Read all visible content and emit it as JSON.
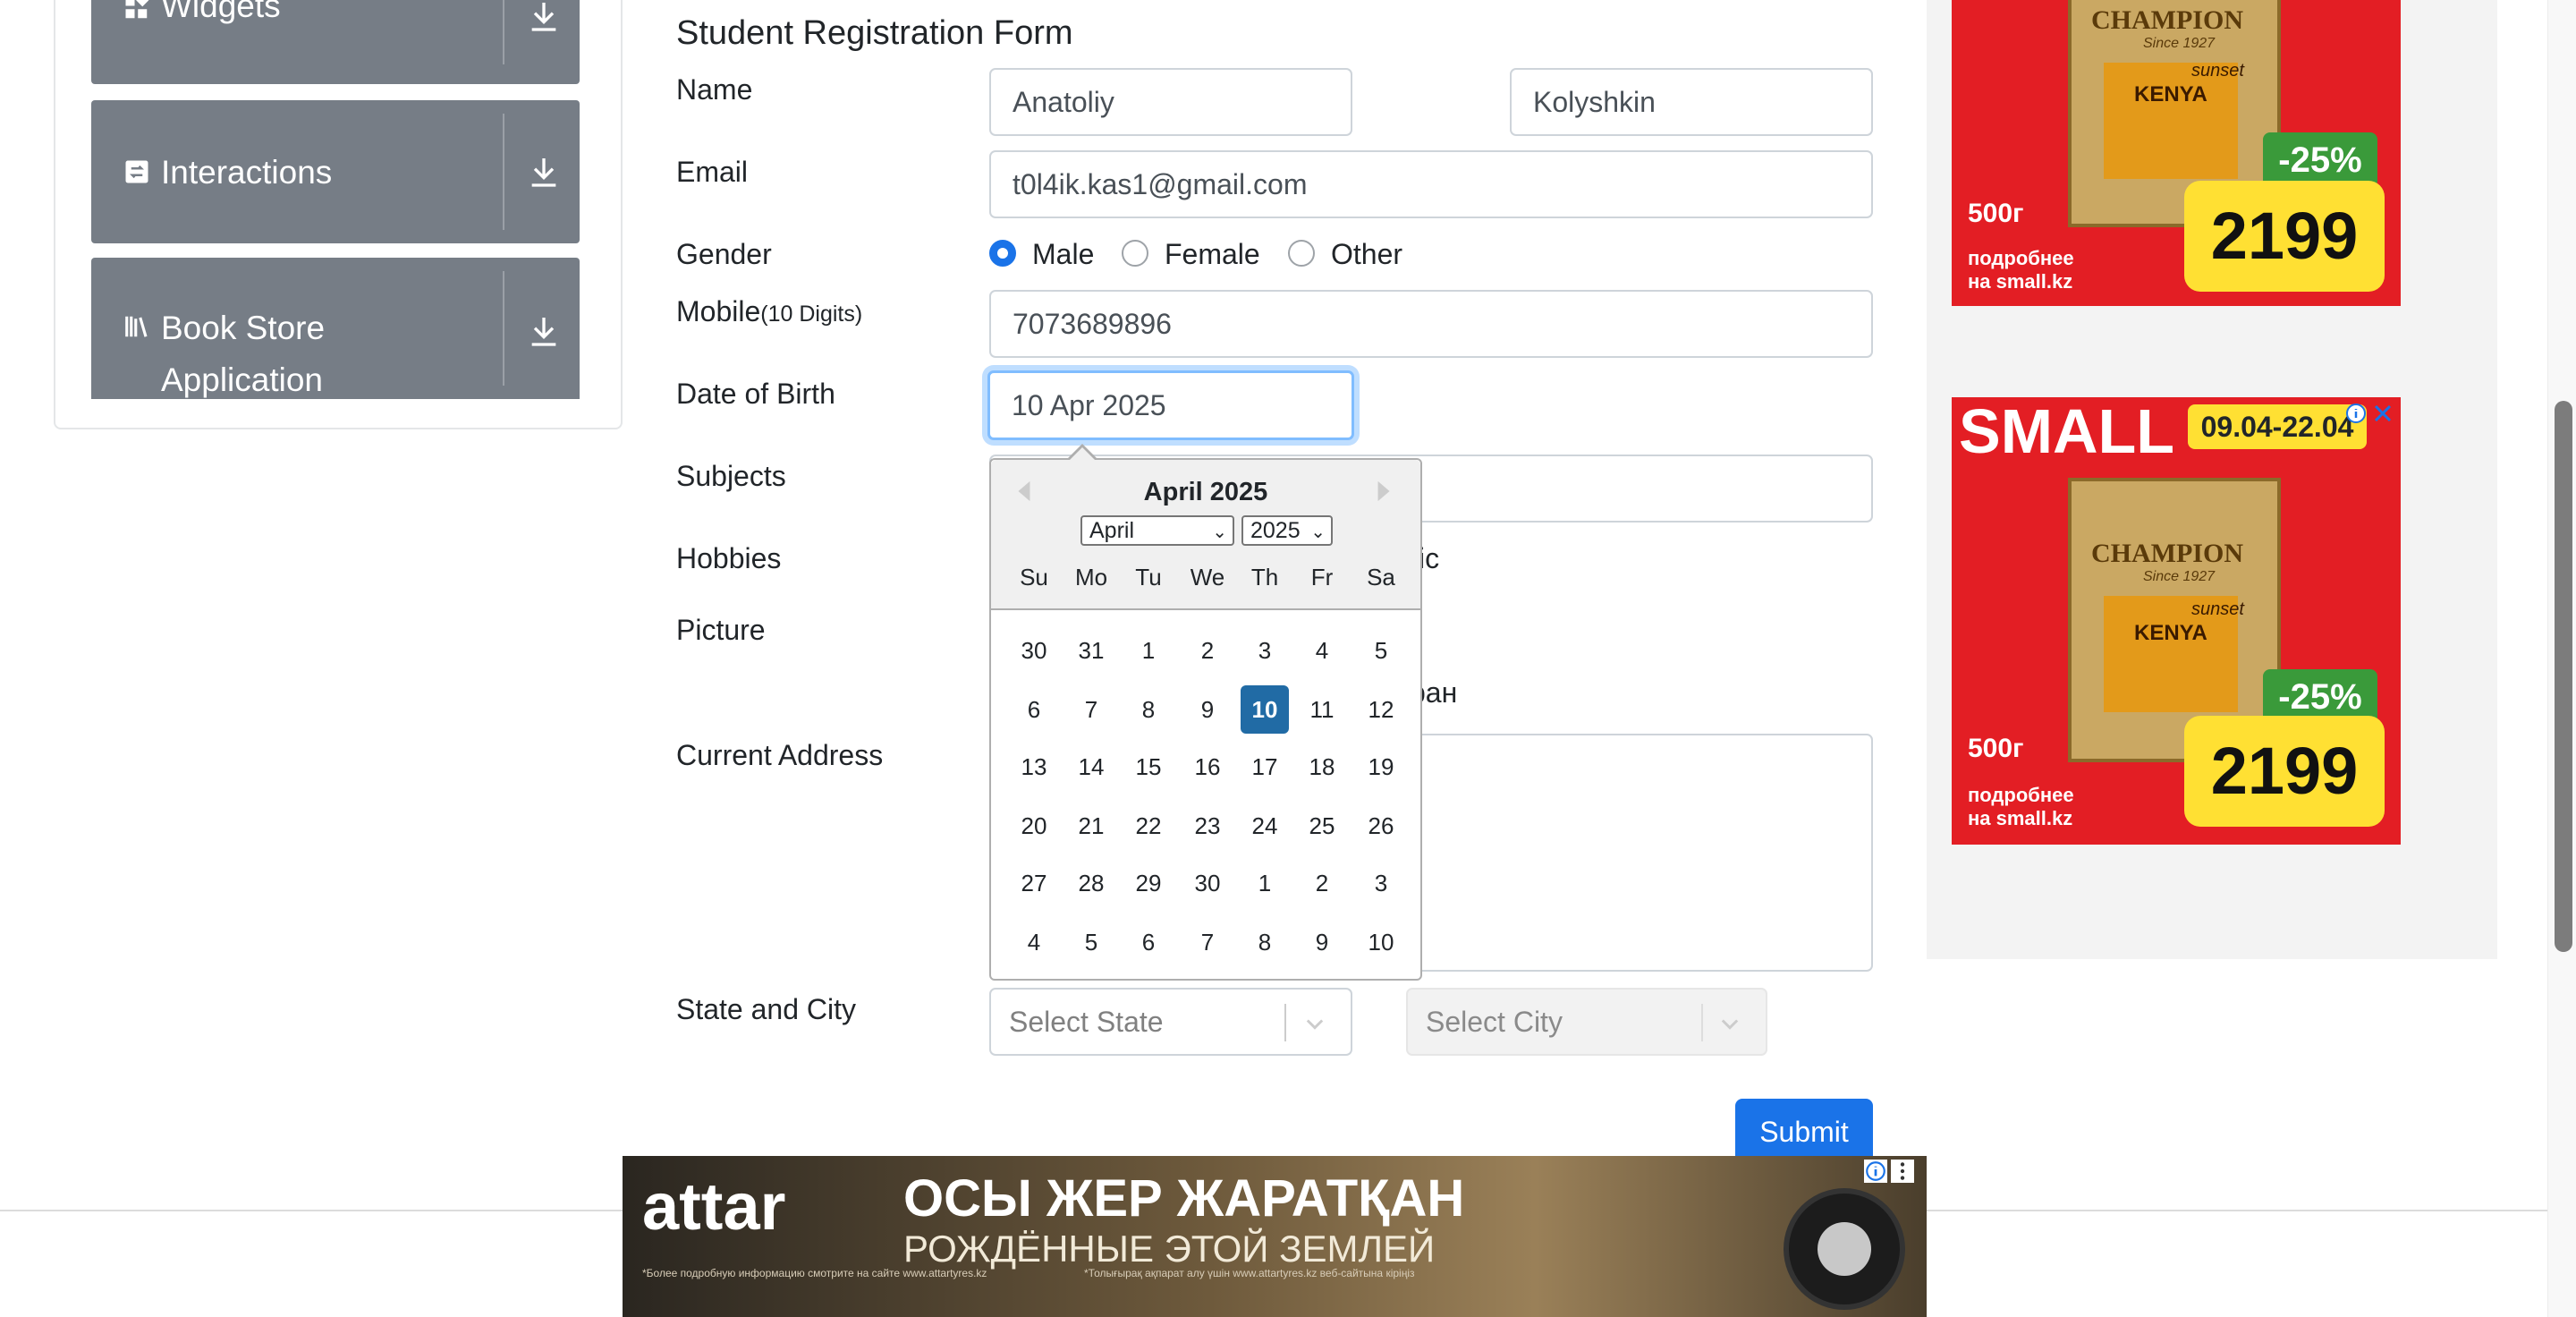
{
  "sidebar": {
    "groups": [
      {
        "label": "Widgets",
        "icon": "widgets-icon"
      },
      {
        "label": "Interactions",
        "icon": "interactions-icon"
      },
      {
        "label": "Book Store Application",
        "label_line1": "Book Store",
        "label_line2": "Application",
        "icon": "book-store-icon"
      }
    ]
  },
  "form": {
    "title": "Student Registration Form",
    "name_label": "Name",
    "first_name": "Anatoliy",
    "last_name": "Kolyshkin",
    "email_label": "Email",
    "email": "t0l4ik.kas1@gmail.com",
    "gender_label": "Gender",
    "gender_options": [
      "Male",
      "Female",
      "Other"
    ],
    "gender_selected": "Male",
    "mobile_label": "Mobile",
    "mobile_hint": "(10 Digits)",
    "mobile": "7073689896",
    "dob_label": "Date of Birth",
    "dob": "10 Apr 2025",
    "subjects_label": "Subjects",
    "hobbies_label": "Hobbies",
    "hobbies_partial": "ic",
    "picture_label": "Picture",
    "picture_partial": "ран",
    "address_label": "Current Address",
    "state_city_label": "State and City",
    "state_placeholder": "Select State",
    "city_placeholder": "Select City",
    "submit_label": "Submit"
  },
  "datepicker": {
    "title": "April 2025",
    "month": "April",
    "year": "2025",
    "weekdays": [
      "Su",
      "Mo",
      "Tu",
      "We",
      "Th",
      "Fr",
      "Sa"
    ],
    "weeks": [
      [
        "30",
        "31",
        "1",
        "2",
        "3",
        "4",
        "5"
      ],
      [
        "6",
        "7",
        "8",
        "9",
        "10",
        "11",
        "12"
      ],
      [
        "13",
        "14",
        "15",
        "16",
        "17",
        "18",
        "19"
      ],
      [
        "20",
        "21",
        "22",
        "23",
        "24",
        "25",
        "26"
      ],
      [
        "27",
        "28",
        "29",
        "30",
        "1",
        "2",
        "3"
      ],
      [
        "4",
        "5",
        "6",
        "7",
        "8",
        "9",
        "10"
      ]
    ],
    "selected_day": "10"
  },
  "ads": {
    "ad1": {
      "brand": "CHAMPION",
      "since": "Since 1927",
      "origin": "KENYA",
      "sub": "sunset",
      "discount": "-25%",
      "weight": "500г",
      "price": "2199",
      "more": "подробнее",
      "site": "на small.kz"
    },
    "ad2": {
      "store": "SMALL",
      "dates": "09.04-22.04",
      "brand": "CHAMPION",
      "since": "Since 1927",
      "origin": "KENYA",
      "sub": "sunset",
      "discount": "-25%",
      "weight": "500г",
      "price": "2199",
      "more": "подробнее",
      "site": "на small.kz"
    },
    "banner": {
      "brand": "attar",
      "headline": "ОСЫ ЖЕР ЖАРАТҚАН",
      "subline": "РОЖДЁННЫЕ ЭТОЙ ЗЕМЛЕЙ",
      "fine1": "*Более подробную информацию смотрите на сайте www.attartyres.kz",
      "fine2": "*Толығырақ ақпарат алу үшін www.attartyres.kz веб-сайтына кіріңіз"
    }
  },
  "colors": {
    "primary": "#1a73e8",
    "sidebar_group": "#767d86",
    "selected_day": "#216ba5",
    "ad_red": "#e31e24",
    "ad_yellow": "#ffe033",
    "ad_green": "#3a9a3a"
  }
}
